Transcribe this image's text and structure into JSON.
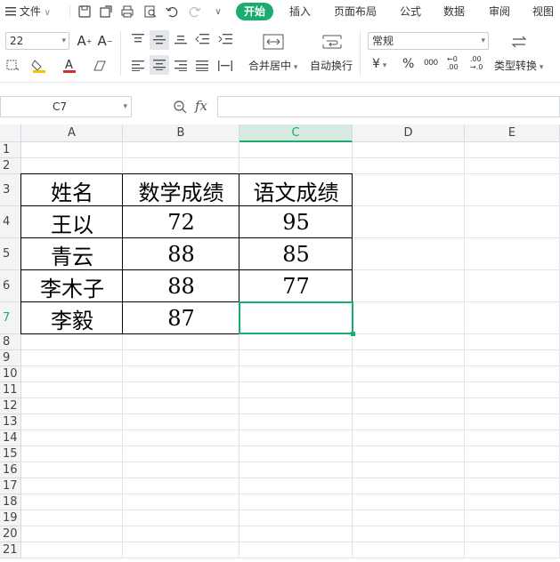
{
  "menu": {
    "file_label": "文件",
    "tabs": [
      "开始",
      "插入",
      "页面布局",
      "公式",
      "数据",
      "审阅",
      "视图"
    ],
    "active_tab": "开始"
  },
  "ribbon": {
    "font_size": "22",
    "merge_label": "合并居中",
    "wrap_label": "自动换行",
    "number_format": "常规",
    "type_convert_label": "类型转换",
    "currency_symbol": "¥",
    "percent_symbol": "%",
    "thousands_symbol": "000",
    "decimal_inc": "←0 .00",
    "decimal_dec": ".00 →.0"
  },
  "formula": {
    "cell_ref": "C7",
    "fx_label": "fx",
    "content": ""
  },
  "columns": [
    "A",
    "B",
    "C",
    "D",
    "E"
  ],
  "selected_column": "C",
  "rows": [
    "1",
    "2",
    "3",
    "4",
    "5",
    "6",
    "7",
    "8",
    "9",
    "10",
    "11",
    "12",
    "13",
    "14",
    "15",
    "16",
    "17",
    "18",
    "19",
    "20",
    "21"
  ],
  "selected_row": "7",
  "table": {
    "headers": [
      "姓名",
      "数学成绩",
      "语文成绩"
    ],
    "records": [
      [
        "王以",
        "72",
        "95"
      ],
      [
        "青云",
        "88",
        "85"
      ],
      [
        "李木子",
        "88",
        "77"
      ],
      [
        "李毅",
        "87",
        ""
      ]
    ]
  }
}
